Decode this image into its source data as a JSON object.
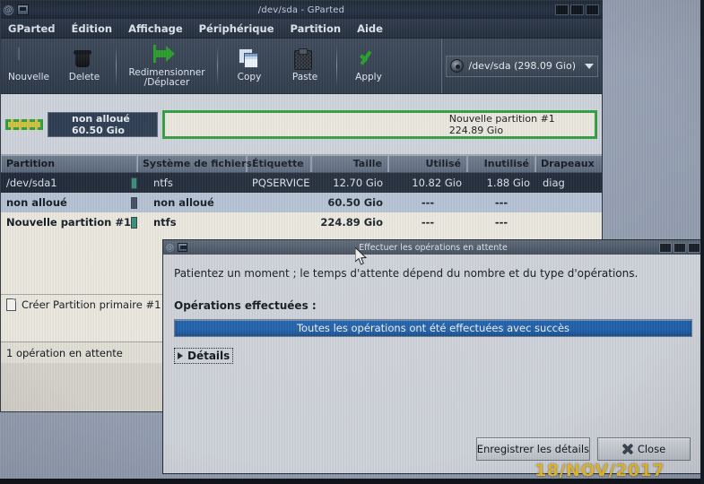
{
  "window": {
    "title": "/dev/sda - GParted",
    "menu": [
      "GParted",
      "Édition",
      "Affichage",
      "Périphérique",
      "Partition",
      "Aide"
    ],
    "titlebar_icons": [
      "window-menu-icon",
      "app-icon"
    ],
    "controls": [
      "minimize-button",
      "maximize-button",
      "close-button"
    ]
  },
  "toolbar": {
    "new_label": "Nouvelle",
    "delete_label": "Delete",
    "resize_label": "Redimensionner\n/Déplacer",
    "resize_line1": "Redimensionner",
    "resize_line2": "/Déplacer",
    "copy_label": "Copy",
    "paste_label": "Paste",
    "apply_label": "Apply",
    "device_value": "/dev/sda  (298.09 Gio)"
  },
  "graphic": {
    "partitions": [
      {
        "name": "/dev/sda1",
        "size": "12.70 Gio",
        "color": "#cfc241",
        "selected": true,
        "label_visible": false
      },
      {
        "name": "non alloué",
        "size": "60.50 Gio",
        "color": "#2b3a50",
        "selected": false,
        "label_visible": true
      },
      {
        "name": "Nouvelle partition #1",
        "size": "224.89 Gio",
        "color": "#ece9df",
        "selected": true,
        "label_visible": true
      }
    ]
  },
  "table": {
    "headers": [
      "Partition",
      "Système de fichiers",
      "Étiquette",
      "Taille",
      "Utilisé",
      "Inutilisé",
      "Drapeaux"
    ],
    "rows": [
      {
        "partition": "/dev/sda1",
        "filesystem": "ntfs",
        "swatch": "#2f8f73",
        "label": "PQSERVICE",
        "size": "12.70 Gio",
        "used": "10.82 Gio",
        "unused": "1.88 Gio",
        "flags": "diag",
        "selected": true
      },
      {
        "partition": "non alloué",
        "filesystem": "non alloué",
        "swatch": "#3c4c63",
        "label": "",
        "size": "60.50 Gio",
        "used": "---",
        "unused": "---",
        "flags": "",
        "selected": false
      },
      {
        "partition": "Nouvelle partition #1",
        "filesystem": "ntfs",
        "swatch": "#2f8f73",
        "label": "",
        "size": "224.89 Gio",
        "used": "---",
        "unused": "---",
        "flags": "",
        "selected": false
      }
    ]
  },
  "pending": {
    "operation_label": "Créer Partition primaire #1",
    "status": "1 opération en attente"
  },
  "dialog": {
    "title": "Effectuer les opérations en attente",
    "message": "Patientez un moment ; le temps d'attente dépend du nombre et du type d'opérations.",
    "section_label": "Opérations effectuées :",
    "progress_text": "Toutes les opérations ont été effectuées avec succès",
    "progress_percent": 100,
    "expander_label": "Détails",
    "save_details_label": "Enregistrer les détails",
    "close_label": "Close",
    "controls": [
      "minimize-button",
      "maximize-button",
      "close-button"
    ]
  },
  "overlay": {
    "date_stamp": "18/NOV/2017"
  },
  "colors": {
    "selection_blue": "#1d5faa",
    "accent_green": "#2f9e3f",
    "ntfs_swatch": "#2f8f73",
    "unallocated_swatch": "#3c4c63",
    "sda1_fill": "#cfc241",
    "date_stamp": "#e8b92b"
  }
}
